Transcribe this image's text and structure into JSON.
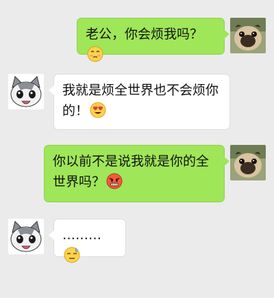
{
  "messages": [
    {
      "sender": "me",
      "text": "老公，你会烦我吗？",
      "emoji": "blush-worried-emoji"
    },
    {
      "sender": "them",
      "text": "我就是烦全世界也不会烦你的！",
      "emoji": "heart-eyes-emoji"
    },
    {
      "sender": "me",
      "text": "你以前不是说我就是你的全世界吗？",
      "emoji": "angry-face-emoji"
    },
    {
      "sender": "them",
      "text": "………",
      "emoji": "sweat-face-emoji"
    }
  ],
  "colors": {
    "background": "#ebebeb",
    "my_bubble": "#9fe658",
    "their_bubble": "#ffffff"
  }
}
